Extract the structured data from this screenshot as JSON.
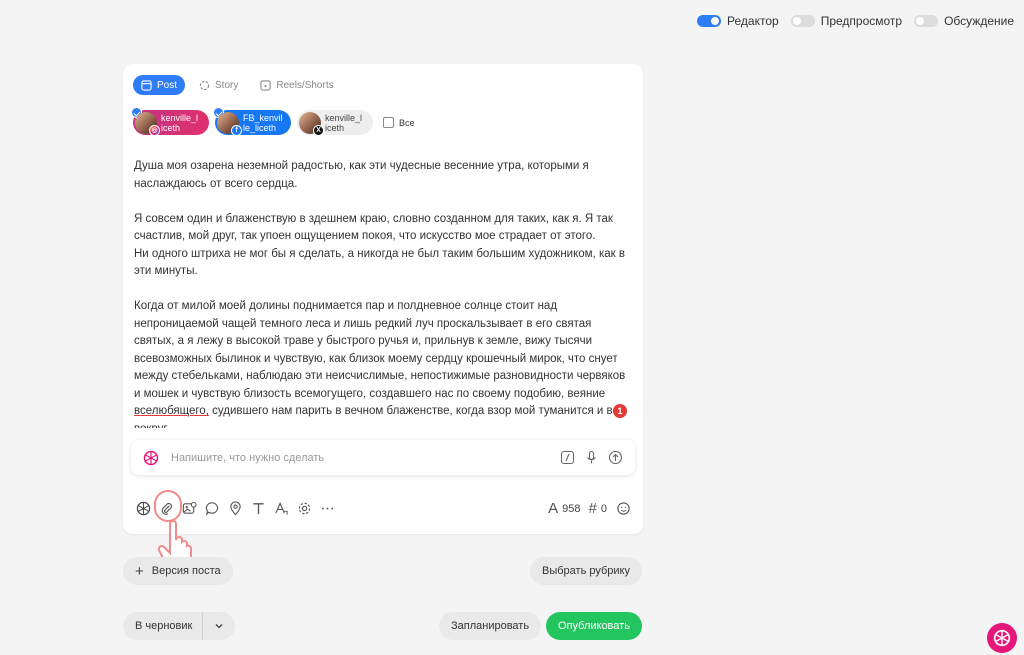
{
  "view_toggles": [
    {
      "label": "Редактор",
      "on": true
    },
    {
      "label": "Предпросмотр",
      "on": false
    },
    {
      "label": "Обсуждение",
      "on": false
    }
  ],
  "tabs": [
    {
      "label": "Post",
      "icon": "post-icon",
      "active": true
    },
    {
      "label": "Story",
      "icon": "story-icon",
      "active": false
    },
    {
      "label": "Reels/Shorts",
      "icon": "reels-icon",
      "active": false
    }
  ],
  "accounts": [
    {
      "name": "kenville_l iceth",
      "network": "instagram",
      "selected": true
    },
    {
      "name": "FB_kenvil le_liceth",
      "network": "facebook",
      "selected": true
    },
    {
      "name": "kenville_l iceth",
      "network": "x",
      "selected": false
    }
  ],
  "all_label": "Все",
  "post_text": {
    "p1": "Душа моя озарена неземной радостью, как эти чудесные весенние утра, которыми я наслаждаюсь от всего сердца.",
    "p2a": "Я совсем один и блаженствую в здешнем краю, словно созданном для таких, как я. Я так счастлив, мой друг, так упоен ощущением покоя, что искусство мое страдает от этого.",
    "p2b": "Ни одного штриха не мог бы я сделать, а никогда не был таким большим художником, как в эти минуты.",
    "p3_start": "Когда от милой моей долины поднимается пар и полдневное солнце стоит над непроницаемой чащей темного леса и лишь редкий луч проскальзывает в его святая святых, а я лежу в высокой траве у быстрого ручья и, прильнув к земле, вижу тысячи всевозможных былинок и чувствую, как близок моему сердцу крошечный мирок, что снует между стебельками, наблюдаю эти неисчислимые, непостижимые разновидности червяков и мошек и чувствую близость всемогущего, создавшего нас по своему подобию, веяние",
    "p3_underlined": "вселюбящего,",
    "p3_end": "судившего нам парить в вечном блаженстве, когда взор мой туманится и все вокруг"
  },
  "grammar_count": "1",
  "ai_prompt": {
    "placeholder": "Напишите, что нужно сделать"
  },
  "toolbar_icons": [
    "ai-icon",
    "attach-icon",
    "media-icon",
    "comment-icon",
    "location-icon",
    "text-icon",
    "font-icon",
    "settings-icon",
    "more-icon"
  ],
  "counters": {
    "chars": "958",
    "hashtags": "0"
  },
  "buttons": {
    "version": "Версия поста",
    "rubric": "Выбрать рубрику",
    "draft": "В черновик",
    "schedule": "Запланировать",
    "publish": "Опубликовать"
  },
  "colors": {
    "accent": "#2f7df6",
    "publish": "#22c55e",
    "brand": "#e6177a"
  }
}
